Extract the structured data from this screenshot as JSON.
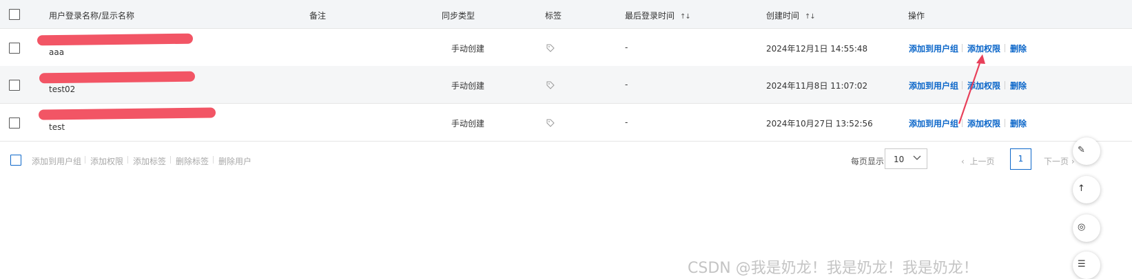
{
  "header": {
    "col_name": "用户登录名称/显示名称",
    "col_note": "备注",
    "col_sync": "同步类型",
    "col_tags": "标签",
    "col_last_login": "最后登录时间",
    "col_created": "创建时间",
    "col_ops": "操作",
    "sort_glyph": "↑↓"
  },
  "rows": [
    {
      "display_name": "aaa",
      "sync_type": "手动创建",
      "last_login": "-",
      "created": "2024年12月1日 14:55:48"
    },
    {
      "display_name": "test02",
      "sync_type": "手动创建",
      "last_login": "-",
      "created": "2024年11月8日 11:07:02"
    },
    {
      "display_name": "test",
      "sync_type": "手动创建",
      "last_login": "-",
      "created": "2024年10月27日 13:52:56"
    }
  ],
  "actions": {
    "add_to_group": "添加到用户组",
    "add_permission": "添加权限",
    "delete": "删除"
  },
  "bulk_actions": [
    "添加到用户组",
    "添加权限",
    "添加标签",
    "删除标签",
    "删除用户"
  ],
  "pagination": {
    "per_page_label": "每页显示",
    "per_page_value": "10",
    "prev": "上一页",
    "current": "1",
    "next": "下一页"
  },
  "watermark": "CSDN @我是奶龙！我是奶龙！我是奶龙！",
  "colors": {
    "link": "#0b66c9",
    "redaction": "#f25565",
    "arrow": "#e8405a"
  }
}
